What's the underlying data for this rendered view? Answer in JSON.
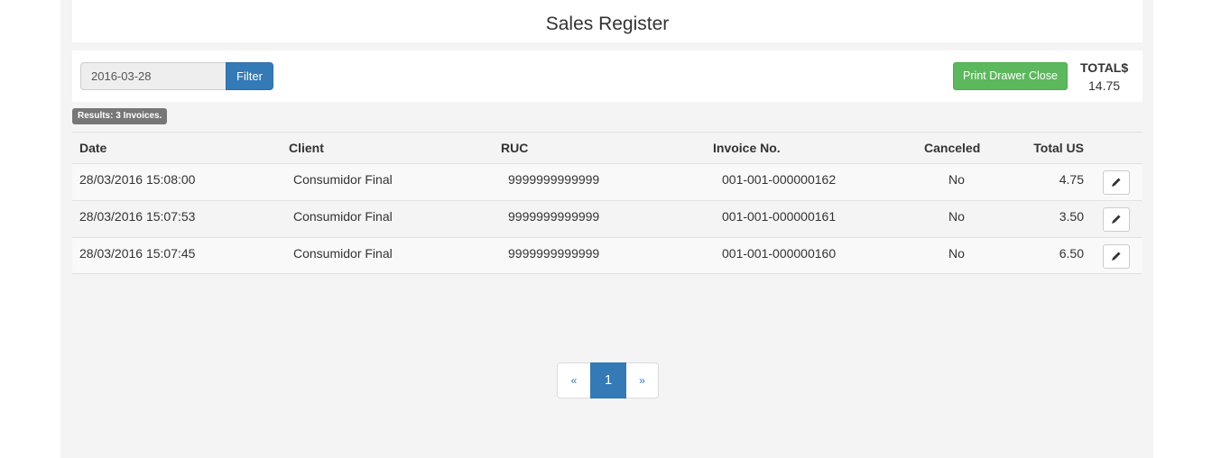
{
  "header": {
    "title": "Sales Register"
  },
  "filter": {
    "date_value": "2016-03-28",
    "filter_label": "Filter",
    "print_label": "Print Drawer Close",
    "total_label": "TOTAL$",
    "total_value": "14.75"
  },
  "results": {
    "badge": "Results: 3 Invoices."
  },
  "table": {
    "columns": [
      "Date",
      "Client",
      "RUC",
      "Invoice No.",
      "Canceled",
      "Total US"
    ],
    "rows": [
      {
        "date": "28/03/2016 15:08:00",
        "client": "Consumidor Final",
        "ruc": "9999999999999",
        "invoice": "001-001-000000162",
        "canceled": "No",
        "total": "4.75"
      },
      {
        "date": "28/03/2016 15:07:53",
        "client": "Consumidor Final",
        "ruc": "9999999999999",
        "invoice": "001-001-000000161",
        "canceled": "No",
        "total": "3.50"
      },
      {
        "date": "28/03/2016 15:07:45",
        "client": "Consumidor Final",
        "ruc": "9999999999999",
        "invoice": "001-001-000000160",
        "canceled": "No",
        "total": "6.50"
      }
    ],
    "row_action_icon": "pencil-icon"
  },
  "pagination": {
    "prev": "«",
    "current": "1",
    "next": "»"
  },
  "colors": {
    "primary": "#337ab7",
    "success": "#5cb85c",
    "badge": "#777777"
  }
}
